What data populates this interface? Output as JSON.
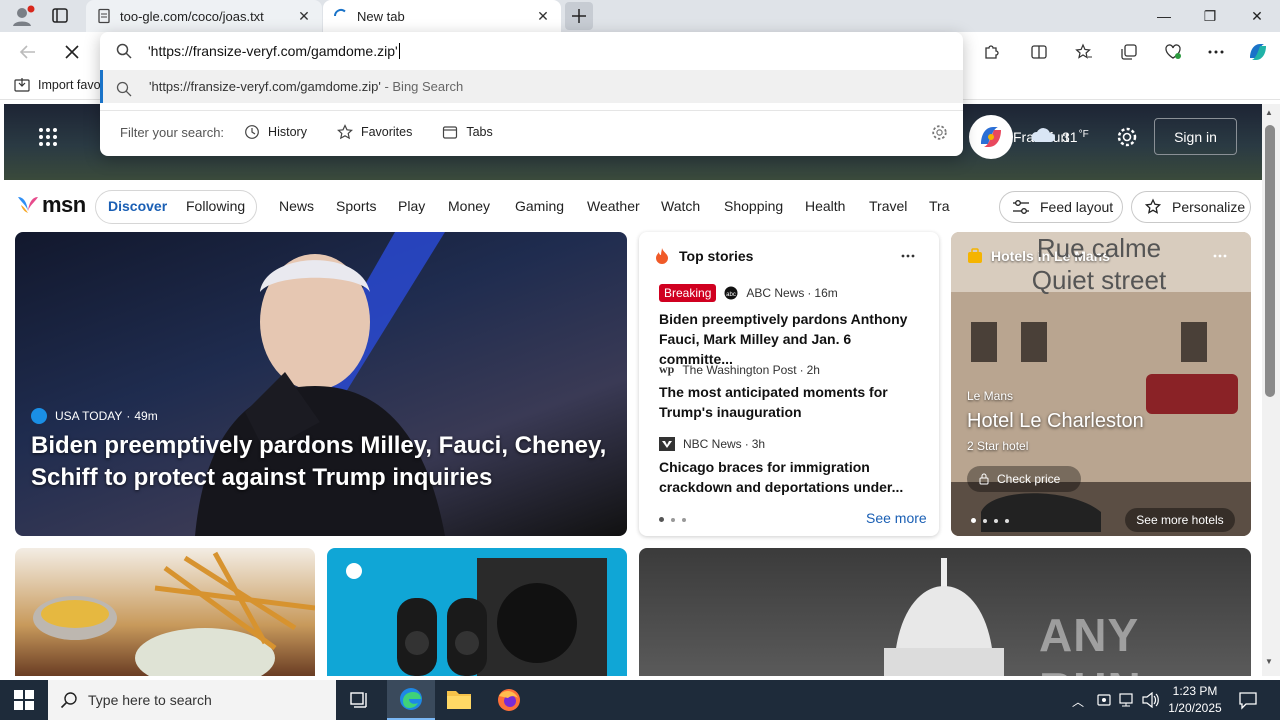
{
  "tabs": [
    {
      "title": "too-gle.com/coco/joas.txt"
    },
    {
      "title": "New tab"
    }
  ],
  "address_bar": {
    "value": "'https://fransize-veryf.com/gamdome.zip'",
    "suggestion_main": "'https://fransize-veryf.com/gamdome.zip'",
    "suggestion_suffix": " - Bing Search",
    "filter_label": "Filter your search:",
    "filters": [
      "History",
      "Favorites",
      "Tabs"
    ]
  },
  "bookmarks": {
    "import": "Import favo"
  },
  "weather": {
    "city": "Frankfurt",
    "temp": "31",
    "unit": "°F"
  },
  "sign_in": "Sign in",
  "msn": {
    "logo": "msn",
    "tabs": [
      "Discover",
      "Following"
    ],
    "nav": [
      "News",
      "Sports",
      "Play",
      "Money",
      "Gaming",
      "Weather",
      "Watch",
      "Shopping",
      "Health",
      "Travel",
      "Tra"
    ],
    "feed_layout": "Feed layout",
    "personalize": "Personalize"
  },
  "hero": {
    "source": "USA TODAY",
    "time": "49m",
    "headline": "Biden preemptively pardons Milley, Fauci, Cheney, Schiff to protect against Trump inquiries"
  },
  "top_stories": {
    "title": "Top stories",
    "breaking": "Breaking",
    "items": [
      {
        "source": "ABC News",
        "time": "16m",
        "title": "Biden preemptively pardons Anthony Fauci, Mark Milley and Jan. 6 committe..."
      },
      {
        "source": "The Washington Post",
        "time": "2h",
        "title": "The most anticipated moments for Trump's inauguration"
      },
      {
        "source": "NBC News",
        "time": "3h",
        "title": "Chicago braces for immigration crackdown and deportations under..."
      }
    ],
    "see_more": "See more"
  },
  "hotels": {
    "title": "Hotels in Le Mans",
    "sign_line1": "Rue calme",
    "sign_line2": "Quiet street",
    "city": "Le Mans",
    "name": "Hotel Le Charleston",
    "stars": "2 Star hotel",
    "check_price": "Check price",
    "see_more": "See more hotels"
  },
  "watermark": "ANY RUN",
  "taskbar": {
    "search_placeholder": "Type here to search",
    "time": "1:23 PM",
    "date": "1/20/2025"
  },
  "colors": {
    "accent": "#1a73c8",
    "breaking": "#d00020",
    "taskbar": "#1e2b3a"
  }
}
